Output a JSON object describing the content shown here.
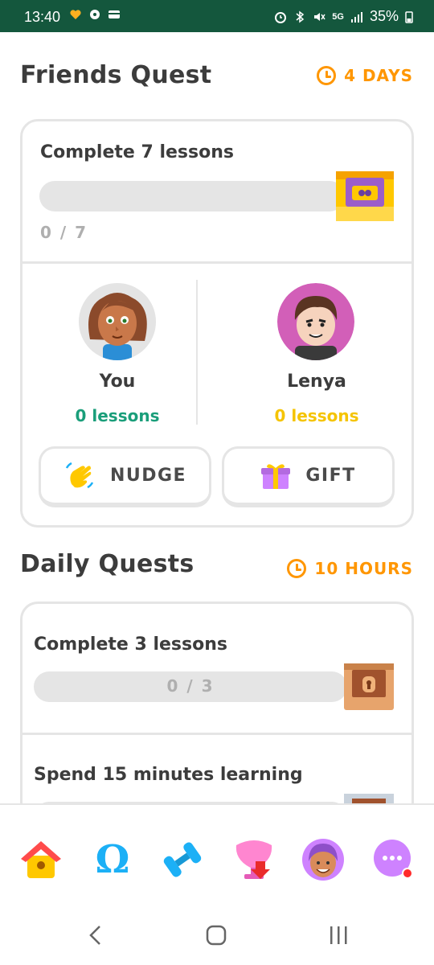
{
  "status_bar": {
    "time": "13:40",
    "battery": "35%",
    "network": "5G"
  },
  "friends_quest": {
    "title": "Friends Quest",
    "timer": "4 DAYS",
    "quest_label": "Complete 7 lessons",
    "progress_text": "0 / 7",
    "progress": 0,
    "you": {
      "name": "You",
      "lessons": "0 lessons"
    },
    "friend": {
      "name": "Lenya",
      "lessons": "0 lessons"
    },
    "nudge_label": "NUDGE",
    "gift_label": "GIFT"
  },
  "daily_quests": {
    "title": "Daily Quests",
    "timer": "10 HOURS",
    "items": [
      {
        "label": "Complete 3 lessons",
        "progress_text": "0 / 3",
        "progress": 0
      },
      {
        "label": "Spend 15 minutes learning"
      }
    ]
  },
  "bottom_nav": {
    "items": [
      "home-icon",
      "letters-icon",
      "practice-dumbbell-icon",
      "leagues-icon",
      "profile-icon",
      "more-icon"
    ]
  },
  "colors": {
    "accent_orange": "#ff9600",
    "green_lessons": "#1a9e7a",
    "yellow_lessons": "#f5c400",
    "border_gray": "#e5e5e5",
    "status_bar": "#14573d"
  }
}
